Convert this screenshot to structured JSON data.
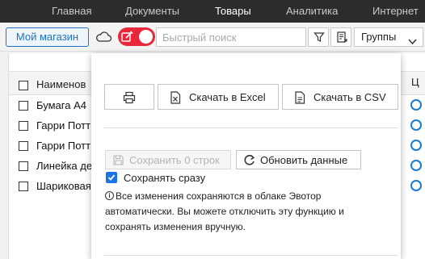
{
  "nav": {
    "items": [
      "Главная",
      "Документы",
      "Товары",
      "Аналитика",
      "Интернет"
    ],
    "active": "Товары"
  },
  "toolbar": {
    "store_label": "Мой магазин",
    "search_placeholder": "Быстрый поиск",
    "groups_label": "Группы",
    "toggle_state": "on",
    "icons": [
      "cloud-icon",
      "edit-icon",
      "filter-icon",
      "export-icon",
      "chevron-down-icon"
    ]
  },
  "table": {
    "header": {
      "name": "Наименов",
      "right": "Ц"
    },
    "rows": [
      {
        "name": "Бумага А4"
      },
      {
        "name": "Гарри Потт"
      },
      {
        "name": "Гарри Потт"
      },
      {
        "name": "Линейка де"
      },
      {
        "name": "Шариковая"
      }
    ]
  },
  "panel": {
    "print_icon": "printer-icon",
    "excel_label": "Скачать в Excel",
    "csv_label": "Скачать в CSV",
    "save_label": "Сохранить 0 строк",
    "refresh_label": "Обновить данные",
    "autosave_label": "Сохранять сразу",
    "autosave_checked": true,
    "info_text": "Все изменения сохраняются в облаке Эвотор автоматически. Вы можете отключить эту функцию и сохранять изменения вручную."
  },
  "colors": {
    "accent": "#1a73c4",
    "toggle": "#e8273a",
    "nav_bg": "#2c2c2c",
    "checkbox": "#1a73e8"
  }
}
